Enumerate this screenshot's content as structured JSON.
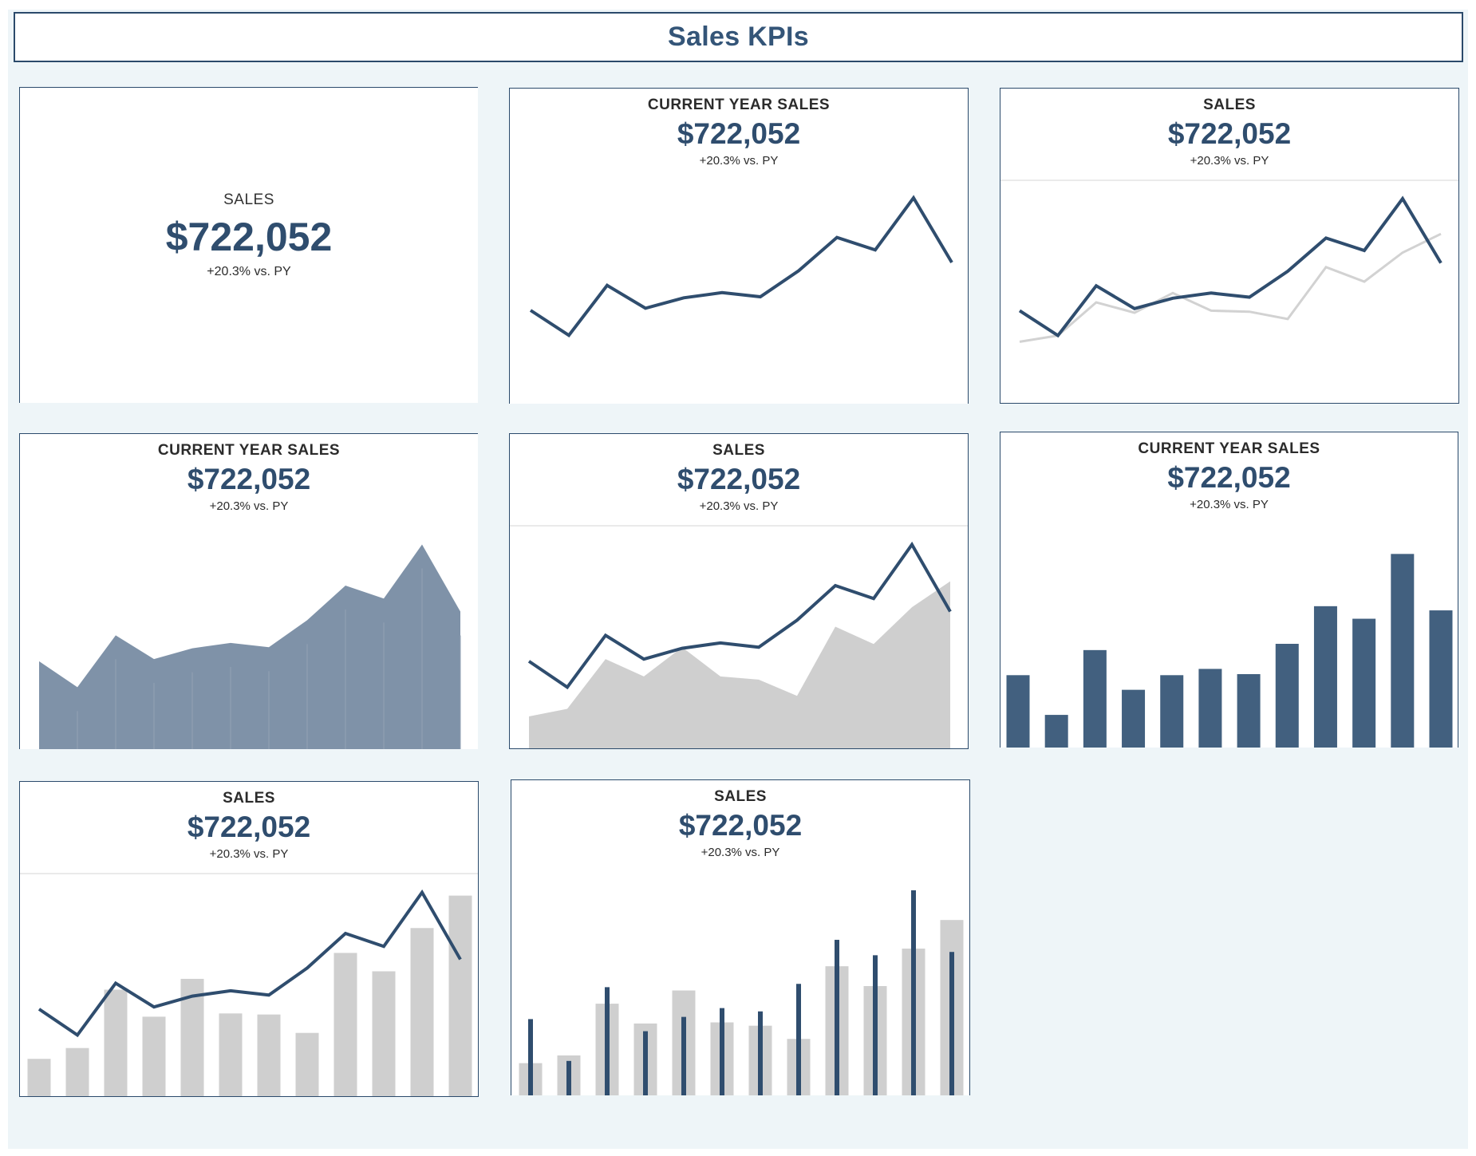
{
  "dashboard": {
    "title": "Sales KPIs"
  },
  "kpi": {
    "label_sales": "SALES",
    "label_cy": "CURRENT YEAR SALES",
    "value": "$722,052",
    "delta": "+20.3% vs. PY"
  },
  "colors": {
    "current": "#2f4d6e",
    "bar": "#42607f",
    "area": "#7f92a8",
    "prior": "#cfcfcf",
    "prior_line": "#d2d2d2"
  },
  "chart_data": [
    {
      "type": "table",
      "title": "SALES",
      "values": []
    },
    {
      "type": "line",
      "title": "CURRENT YEAR SALES",
      "series": [
        {
          "values": [
            41000,
            29000,
            53000,
            42000,
            47000,
            49500,
            47500,
            60000,
            76000,
            70000,
            95000,
            64000
          ]
        }
      ]
    },
    {
      "type": "line",
      "title": "SALES",
      "series": [
        {
          "values": [
            41000,
            29000,
            53000,
            42000,
            47000,
            49500,
            47500,
            60000,
            76000,
            70000,
            95000,
            64000
          ]
        },
        {
          "values": [
            26000,
            29000,
            45000,
            40000,
            49500,
            41000,
            40500,
            37000,
            62000,
            55000,
            69000,
            78000
          ]
        }
      ]
    },
    {
      "type": "area",
      "title": "CURRENT YEAR SALES",
      "series": [
        {
          "values": [
            41000,
            29000,
            53000,
            42000,
            47000,
            49500,
            47500,
            60000,
            76000,
            70000,
            95000,
            64000
          ]
        }
      ]
    },
    {
      "type": "area",
      "title": "SALES",
      "series": [
        {
          "values": [
            41000,
            29000,
            53000,
            42000,
            47000,
            49500,
            47500,
            60000,
            76000,
            70000,
            95000,
            64000
          ]
        },
        {
          "values": [
            15500,
            19000,
            42000,
            34000,
            47500,
            34000,
            32500,
            25000,
            57000,
            49000,
            66000,
            78000
          ]
        }
      ]
    },
    {
      "type": "bar",
      "title": "CURRENT YEAR SALES",
      "series": [
        {
          "values": [
            35000,
            16000,
            47000,
            28000,
            35000,
            38000,
            35500,
            50000,
            68000,
            62000,
            93000,
            66000
          ]
        }
      ]
    },
    {
      "type": "bar",
      "title": "SALES",
      "series": [
        {
          "values": [
            41000,
            29000,
            53000,
            42000,
            47000,
            49500,
            47500,
            60000,
            76000,
            70000,
            95000,
            64000
          ]
        },
        {
          "values": [
            18000,
            23000,
            50000,
            37500,
            55000,
            39000,
            38500,
            30000,
            67000,
            58500,
            78500,
            93500
          ]
        }
      ]
    },
    {
      "type": "bar",
      "title": "SALES",
      "series": [
        {
          "values": [
            35000,
            16000,
            49500,
            29500,
            36000,
            40000,
            38500,
            51000,
            71000,
            64000,
            93500,
            65500
          ]
        },
        {
          "values": [
            15000,
            18500,
            42000,
            33000,
            48000,
            33500,
            32000,
            26000,
            59000,
            50000,
            67000,
            80000
          ]
        }
      ]
    }
  ]
}
